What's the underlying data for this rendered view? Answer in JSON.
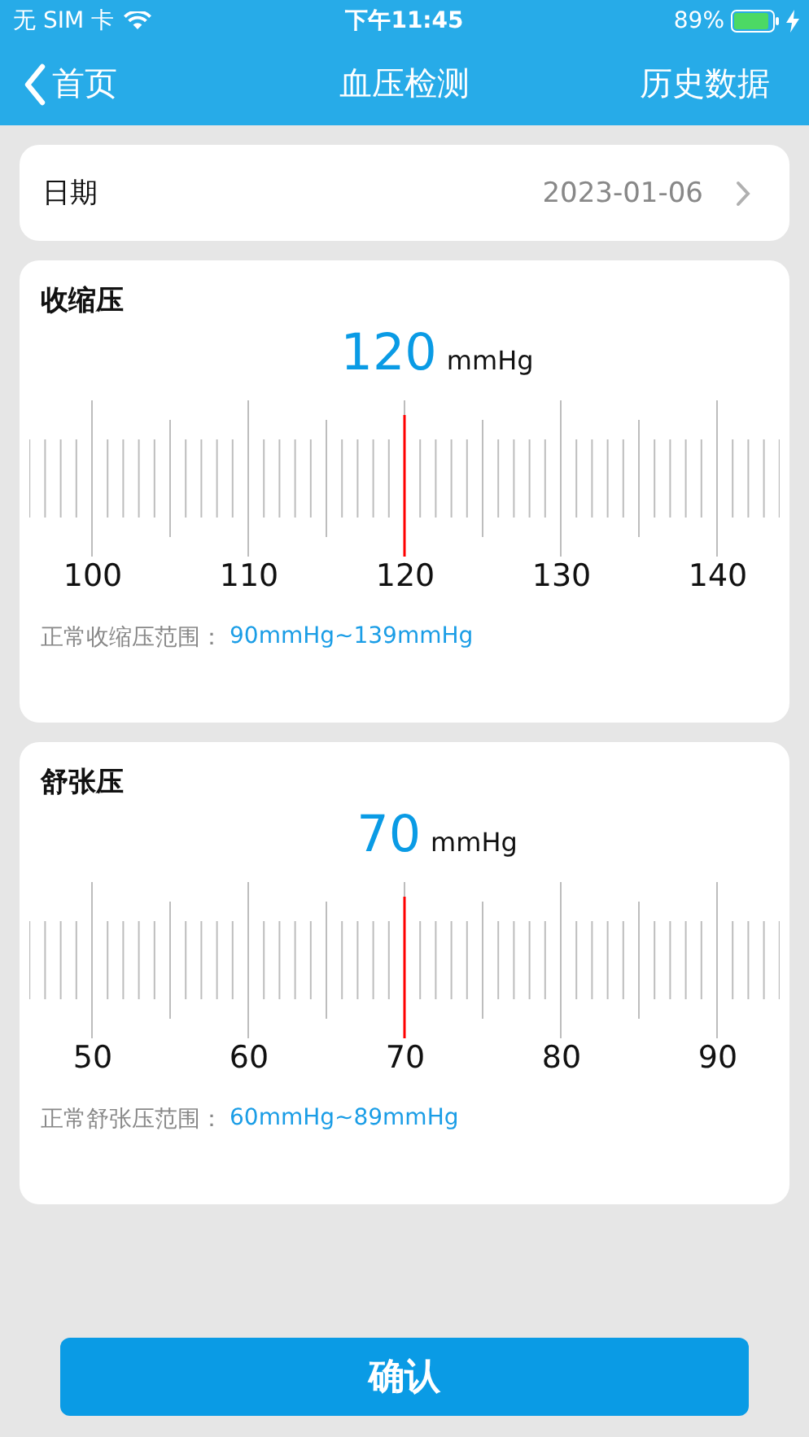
{
  "status_bar": {
    "carrier": "无 SIM 卡",
    "time": "下午11:45",
    "battery": "89%"
  },
  "nav": {
    "back": "首页",
    "title": "血压检测",
    "action": "历史数据"
  },
  "date": {
    "label": "日期",
    "value": "2023-01-06"
  },
  "measures": [
    {
      "title": "收缩压",
      "value": "120",
      "unit": "mmHg",
      "scale_labels": [
        "100",
        "110",
        "120",
        "130",
        "140"
      ],
      "range_label": "正常收缩压范围：",
      "range": "90mmHg~139mmHg"
    },
    {
      "title": "舒张压",
      "value": "70",
      "unit": "mmHg",
      "scale_labels": [
        "50",
        "60",
        "70",
        "80",
        "90"
      ],
      "range_label": "正常舒张压范围：",
      "range": "60mmHg~89mmHg"
    }
  ],
  "confirm": "确认"
}
